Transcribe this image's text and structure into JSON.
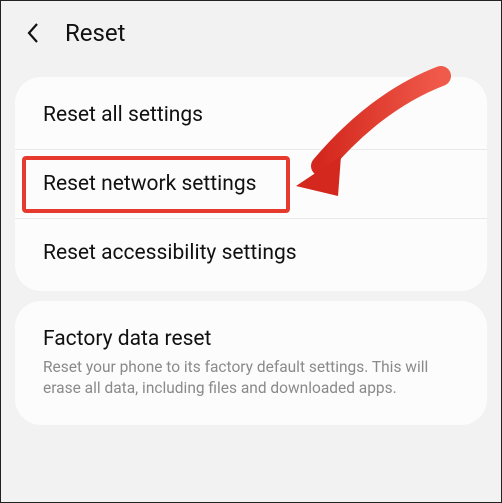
{
  "header": {
    "title": "Reset"
  },
  "group1": {
    "items": [
      {
        "title": "Reset all settings"
      },
      {
        "title": "Reset network settings"
      },
      {
        "title": "Reset accessibility settings"
      }
    ]
  },
  "group2": {
    "items": [
      {
        "title": "Factory data reset",
        "subtitle": "Reset your phone to its factory default settings. This will erase all data, including files and downloaded apps."
      }
    ]
  },
  "annotation": {
    "highlight_color": "#e63a2e",
    "arrow_color": "#e63a2e"
  }
}
